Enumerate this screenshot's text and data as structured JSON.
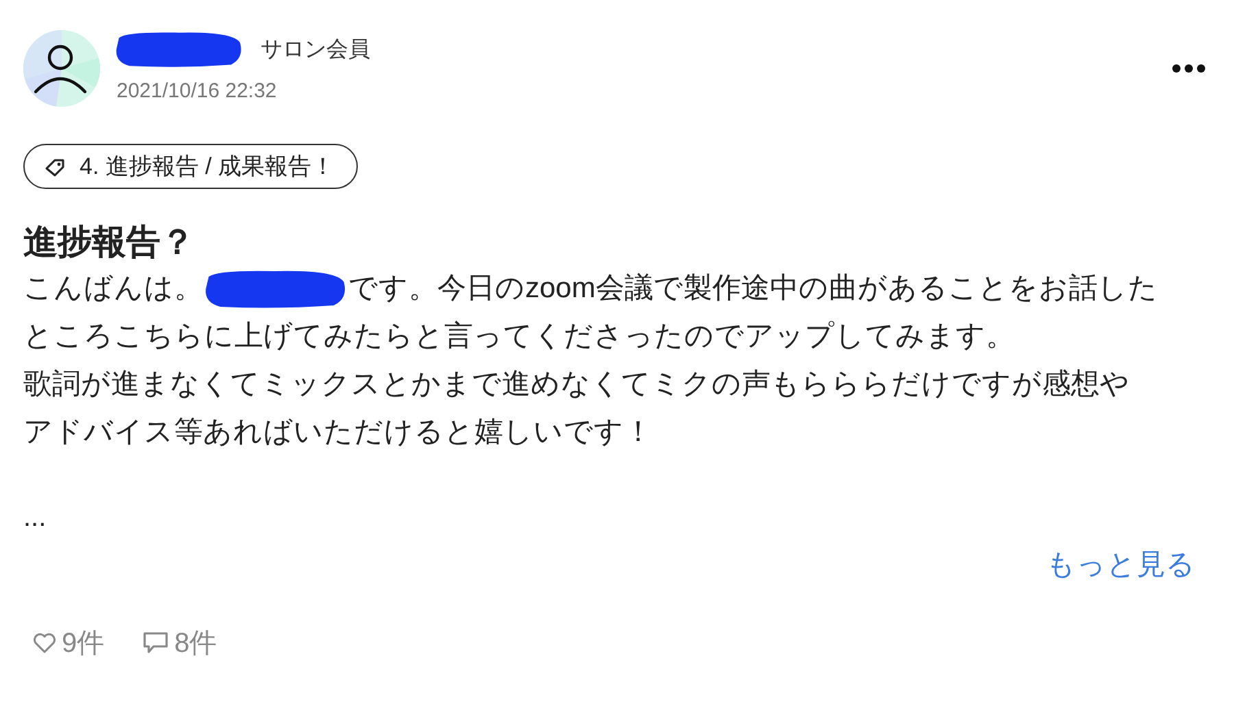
{
  "author": {
    "badge": "サロン会員",
    "timestamp": "2021/10/16 22:32"
  },
  "tag": {
    "label": "4. 進捗報告 / 成果報告！"
  },
  "post": {
    "title": "進捗報告？",
    "greeting": "こんばんは。",
    "first_line_rest": "です。今日のzoom会議で製作途中の曲があることをお話した",
    "lines": [
      "ところこちらに上げてみたらと言ってくださったのでアップしてみます。",
      "歌詞が進まなくてミックスとかまで進めなくてミクの声もらららだけですが感想や",
      "アドバイス等あればいただけると嬉しいです！"
    ],
    "ellipsis": "...",
    "more_link": "もっと見る"
  },
  "reactions": {
    "likes": "9件",
    "comments": "8件"
  }
}
